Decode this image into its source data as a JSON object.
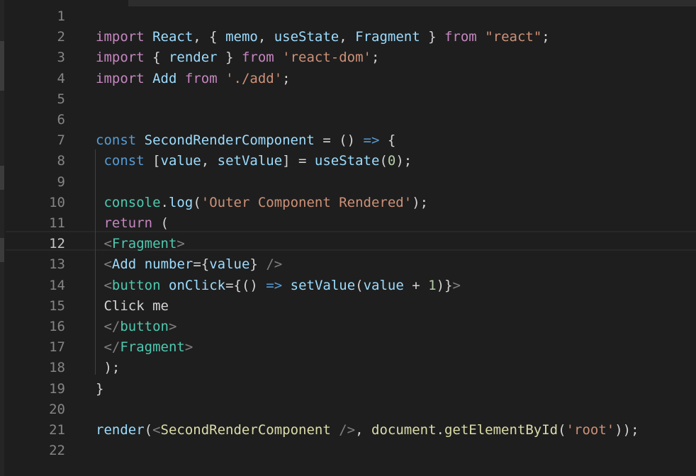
{
  "editor": {
    "active_line": 12,
    "theme_colors": {
      "background": "#1e1e1e",
      "keyword_control": "#c586c0",
      "keyword": "#569cd6",
      "variable": "#9cdcfe",
      "function": "#dcdcaa",
      "string": "#ce9178",
      "number": "#b5cea8",
      "tag": "#4ec9b0",
      "bracket": "#808080",
      "text": "#d4d4d4"
    },
    "lines": [
      {
        "n": "1",
        "tokens": []
      },
      {
        "n": "2",
        "tokens": [
          {
            "t": "import",
            "c": "#c586c0"
          },
          {
            "t": " ",
            "c": "#d4d4d4"
          },
          {
            "t": "React",
            "c": "#9cdcfe"
          },
          {
            "t": ", { ",
            "c": "#d4d4d4"
          },
          {
            "t": "memo",
            "c": "#9cdcfe"
          },
          {
            "t": ", ",
            "c": "#d4d4d4"
          },
          {
            "t": "useState",
            "c": "#9cdcfe"
          },
          {
            "t": ", ",
            "c": "#d4d4d4"
          },
          {
            "t": "Fragment",
            "c": "#9cdcfe"
          },
          {
            "t": " } ",
            "c": "#d4d4d4"
          },
          {
            "t": "from",
            "c": "#c586c0"
          },
          {
            "t": " ",
            "c": "#d4d4d4"
          },
          {
            "t": "\"react\"",
            "c": "#ce9178"
          },
          {
            "t": ";",
            "c": "#d4d4d4"
          }
        ]
      },
      {
        "n": "3",
        "tokens": [
          {
            "t": "import",
            "c": "#c586c0"
          },
          {
            "t": " { ",
            "c": "#d4d4d4"
          },
          {
            "t": "render",
            "c": "#9cdcfe"
          },
          {
            "t": " } ",
            "c": "#d4d4d4"
          },
          {
            "t": "from",
            "c": "#c586c0"
          },
          {
            "t": " ",
            "c": "#d4d4d4"
          },
          {
            "t": "'react-dom'",
            "c": "#ce9178"
          },
          {
            "t": ";",
            "c": "#d4d4d4"
          }
        ]
      },
      {
        "n": "4",
        "tokens": [
          {
            "t": "import",
            "c": "#c586c0"
          },
          {
            "t": " ",
            "c": "#d4d4d4"
          },
          {
            "t": "Add",
            "c": "#9cdcfe"
          },
          {
            "t": " ",
            "c": "#d4d4d4"
          },
          {
            "t": "from",
            "c": "#c586c0"
          },
          {
            "t": " ",
            "c": "#d4d4d4"
          },
          {
            "t": "'./add'",
            "c": "#ce9178"
          },
          {
            "t": ";",
            "c": "#d4d4d4"
          }
        ]
      },
      {
        "n": "5",
        "tokens": []
      },
      {
        "n": "6",
        "tokens": []
      },
      {
        "n": "7",
        "tokens": [
          {
            "t": "const",
            "c": "#569cd6"
          },
          {
            "t": " ",
            "c": "#d4d4d4"
          },
          {
            "t": "SecondRenderComponent",
            "c": "#9cdcfe"
          },
          {
            "t": " = () ",
            "c": "#d4d4d4"
          },
          {
            "t": "=>",
            "c": "#569cd6"
          },
          {
            "t": " {",
            "c": "#d4d4d4"
          }
        ]
      },
      {
        "n": "8",
        "tokens": [
          {
            "t": " ",
            "c": "#d4d4d4"
          },
          {
            "t": "const",
            "c": "#569cd6"
          },
          {
            "t": " [",
            "c": "#d4d4d4"
          },
          {
            "t": "value",
            "c": "#9cdcfe"
          },
          {
            "t": ", ",
            "c": "#d4d4d4"
          },
          {
            "t": "setValue",
            "c": "#9cdcfe"
          },
          {
            "t": "] = ",
            "c": "#d4d4d4"
          },
          {
            "t": "useState",
            "c": "#9cdcfe"
          },
          {
            "t": "(",
            "c": "#d4d4d4"
          },
          {
            "t": "0",
            "c": "#b5cea8"
          },
          {
            "t": ");",
            "c": "#d4d4d4"
          }
        ]
      },
      {
        "n": "9",
        "tokens": []
      },
      {
        "n": "10",
        "tokens": [
          {
            "t": " ",
            "c": "#d4d4d4"
          },
          {
            "t": "console",
            "c": "#4ec9b0"
          },
          {
            "t": ".",
            "c": "#d4d4d4"
          },
          {
            "t": "log",
            "c": "#9cdcfe"
          },
          {
            "t": "(",
            "c": "#d4d4d4"
          },
          {
            "t": "'Outer Component Rendered'",
            "c": "#ce9178"
          },
          {
            "t": ");",
            "c": "#d4d4d4"
          }
        ]
      },
      {
        "n": "11",
        "tokens": [
          {
            "t": " ",
            "c": "#d4d4d4"
          },
          {
            "t": "return",
            "c": "#c586c0"
          },
          {
            "t": " (",
            "c": "#d4d4d4"
          }
        ]
      },
      {
        "n": "12",
        "tokens": [
          {
            "t": " ",
            "c": "#d4d4d4"
          },
          {
            "t": "<",
            "c": "#808080"
          },
          {
            "t": "Fragment",
            "c": "#4ec9b0"
          },
          {
            "t": ">",
            "c": "#808080"
          }
        ]
      },
      {
        "n": "13",
        "tokens": [
          {
            "t": " ",
            "c": "#d4d4d4"
          },
          {
            "t": "<",
            "c": "#808080"
          },
          {
            "t": "Add",
            "c": "#9cdcfe"
          },
          {
            "t": " ",
            "c": "#d4d4d4"
          },
          {
            "t": "number",
            "c": "#9cdcfe"
          },
          {
            "t": "={",
            "c": "#d4d4d4"
          },
          {
            "t": "value",
            "c": "#9cdcfe"
          },
          {
            "t": "} ",
            "c": "#d4d4d4"
          },
          {
            "t": "/>",
            "c": "#808080"
          }
        ]
      },
      {
        "n": "14",
        "tokens": [
          {
            "t": " ",
            "c": "#d4d4d4"
          },
          {
            "t": "<",
            "c": "#808080"
          },
          {
            "t": "button",
            "c": "#4ec9b0"
          },
          {
            "t": " ",
            "c": "#d4d4d4"
          },
          {
            "t": "onClick",
            "c": "#9cdcfe"
          },
          {
            "t": "={() ",
            "c": "#d4d4d4"
          },
          {
            "t": "=>",
            "c": "#569cd6"
          },
          {
            "t": " ",
            "c": "#d4d4d4"
          },
          {
            "t": "setValue",
            "c": "#9cdcfe"
          },
          {
            "t": "(",
            "c": "#d4d4d4"
          },
          {
            "t": "value",
            "c": "#9cdcfe"
          },
          {
            "t": " + ",
            "c": "#d4d4d4"
          },
          {
            "t": "1",
            "c": "#b5cea8"
          },
          {
            "t": ")}",
            "c": "#d4d4d4"
          },
          {
            "t": ">",
            "c": "#808080"
          }
        ]
      },
      {
        "n": "15",
        "tokens": [
          {
            "t": " Click me",
            "c": "#d4d4d4"
          }
        ]
      },
      {
        "n": "16",
        "tokens": [
          {
            "t": " ",
            "c": "#d4d4d4"
          },
          {
            "t": "</",
            "c": "#808080"
          },
          {
            "t": "button",
            "c": "#4ec9b0"
          },
          {
            "t": ">",
            "c": "#808080"
          }
        ]
      },
      {
        "n": "17",
        "tokens": [
          {
            "t": " ",
            "c": "#d4d4d4"
          },
          {
            "t": "</",
            "c": "#808080"
          },
          {
            "t": "Fragment",
            "c": "#4ec9b0"
          },
          {
            "t": ">",
            "c": "#808080"
          }
        ]
      },
      {
        "n": "18",
        "tokens": [
          {
            "t": " );",
            "c": "#d4d4d4"
          }
        ]
      },
      {
        "n": "19",
        "tokens": [
          {
            "t": "}",
            "c": "#d4d4d4"
          }
        ]
      },
      {
        "n": "20",
        "tokens": []
      },
      {
        "n": "21",
        "tokens": [
          {
            "t": "render",
            "c": "#9cdcfe"
          },
          {
            "t": "(",
            "c": "#d4d4d4"
          },
          {
            "t": "<",
            "c": "#808080"
          },
          {
            "t": "SecondRenderComponent",
            "c": "#dcdcaa"
          },
          {
            "t": " ",
            "c": "#d4d4d4"
          },
          {
            "t": "/>",
            "c": "#808080"
          },
          {
            "t": ", ",
            "c": "#d4d4d4"
          },
          {
            "t": "document",
            "c": "#dcdcaa"
          },
          {
            "t": ".",
            "c": "#d4d4d4"
          },
          {
            "t": "getElementById",
            "c": "#dcdcaa"
          },
          {
            "t": "(",
            "c": "#d4d4d4"
          },
          {
            "t": "'root'",
            "c": "#ce9178"
          },
          {
            "t": "));",
            "c": "#d4d4d4"
          }
        ]
      },
      {
        "n": "22",
        "tokens": []
      }
    ]
  }
}
